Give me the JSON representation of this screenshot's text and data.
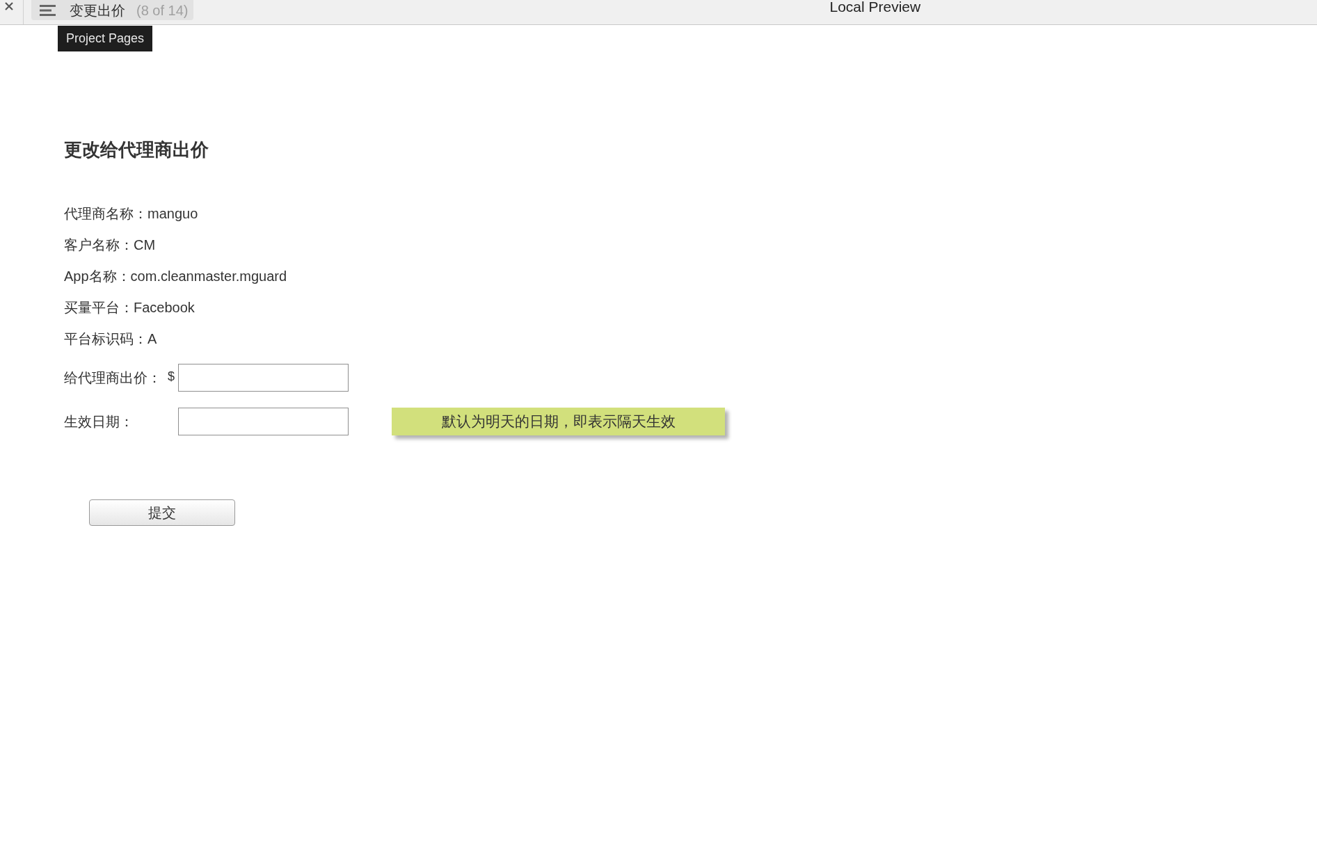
{
  "toolbar": {
    "page_title": "变更出价",
    "page_position": "(8 of 14)",
    "preview_title": "Local Preview"
  },
  "tooltip": "Project Pages",
  "form": {
    "title": "更改给代理商出价",
    "details": [
      {
        "label": "代理商名称：",
        "value": "manguo"
      },
      {
        "label": "客户名称：",
        "value": "CM"
      },
      {
        "label": "App名称：",
        "value": "com.cleanmaster.mguard"
      },
      {
        "label": "买量平台：",
        "value": "Facebook"
      },
      {
        "label": "平台标识码：",
        "value": "A"
      }
    ],
    "fields": [
      {
        "label": "给代理商出价：",
        "prefix": "$"
      },
      {
        "label": "生效日期：",
        "note": "默认为明天的日期，即表示隔天生效"
      }
    ],
    "submit": "提交"
  }
}
